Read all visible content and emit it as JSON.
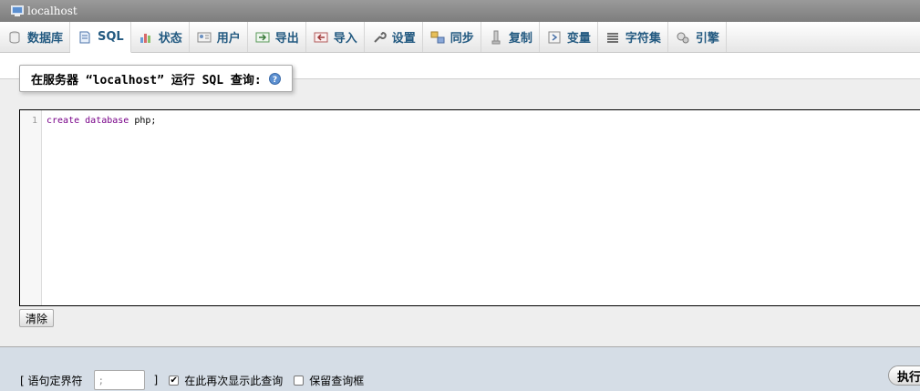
{
  "window": {
    "title": "localhost"
  },
  "tabs": [
    {
      "label": "数据库",
      "icon": "database-icon"
    },
    {
      "label": "SQL",
      "icon": "sql-icon",
      "active": true
    },
    {
      "label": "状态",
      "icon": "status-icon"
    },
    {
      "label": "用户",
      "icon": "users-icon"
    },
    {
      "label": "导出",
      "icon": "export-icon"
    },
    {
      "label": "导入",
      "icon": "import-icon"
    },
    {
      "label": "设置",
      "icon": "settings-wrench-icon"
    },
    {
      "label": "同步",
      "icon": "sync-icon"
    },
    {
      "label": "复制",
      "icon": "replication-icon"
    },
    {
      "label": "变量",
      "icon": "variables-icon"
    },
    {
      "label": "字符集",
      "icon": "charset-icon"
    },
    {
      "label": "引擎",
      "icon": "engines-icon"
    }
  ],
  "query_panel": {
    "legend": "在服务器 “localhost” 运行 SQL 查询:",
    "line_number": "1",
    "code": {
      "kw1": "create",
      "kw2": "database",
      "ident": "php;"
    },
    "clear_label": "清除"
  },
  "options": {
    "delimiter_open": "[ 语句定界符",
    "delimiter_value": ";",
    "delimiter_close": "]",
    "show_again_label": "在此再次显示此查询",
    "show_again_checked": true,
    "keep_box_label": "保留查询框",
    "keep_box_checked": false,
    "go_label": "执行"
  },
  "colors": {
    "tab_text": "#235a81",
    "keyword": "#770088",
    "footer_bg": "#d5dde6"
  }
}
